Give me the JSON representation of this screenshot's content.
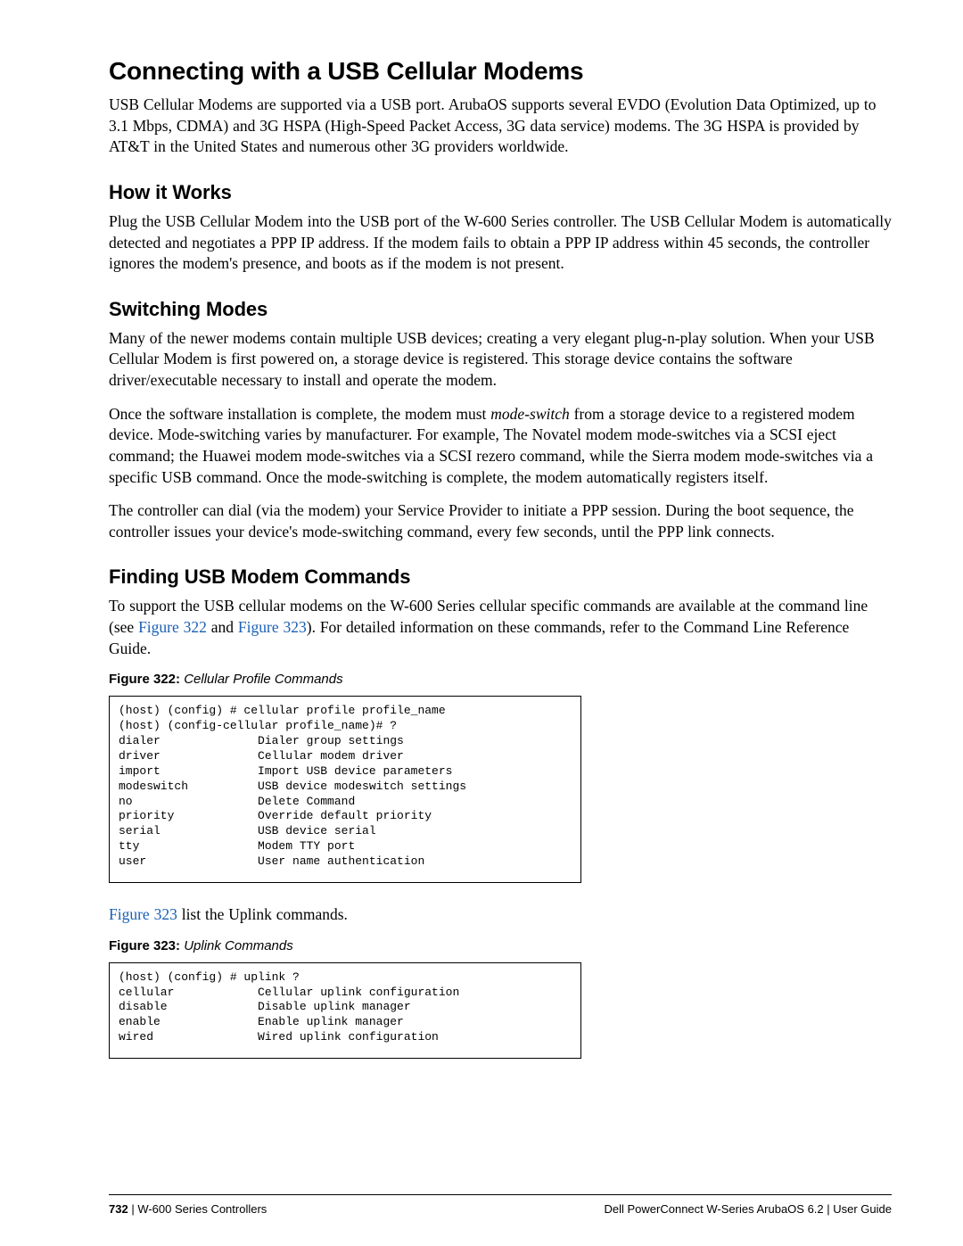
{
  "title": "Connecting with a USB Cellular Modems",
  "intro": "USB Cellular Modems are supported via a USB port. ArubaOS supports several EVDO (Evolution Data Optimized, up to 3.1 Mbps, CDMA) and 3G HSPA (High-Speed Packet Access, 3G data service) modems. The 3G HSPA is provided by AT&T in the United States and numerous other 3G providers worldwide.",
  "how": {
    "heading": "How it Works",
    "p1": "Plug the USB Cellular Modem into the USB port of the W-600 Series  controller. The USB Cellular Modem is automatically detected and negotiates a PPP IP address. If the modem fails to obtain a PPP IP address within 45 seconds, the controller ignores the modem's presence, and boots as if the modem is not present."
  },
  "switching": {
    "heading": "Switching Modes",
    "p1": "Many of the newer modems contain multiple USB devices; creating a very elegant plug-n-play solution. When your USB Cellular Modem is first powered on, a storage device is registered. This storage device contains the software driver/executable necessary to install and operate the modem.",
    "p2a": "Once the software installation is complete, the modem must ",
    "p2_em": "mode-switch",
    "p2b": " from a storage device to a registered modem device. Mode-switching varies by manufacturer. For example, The Novatel modem mode-switches via a SCSI eject command; the Huawei modem mode-switches via a SCSI rezero command, while the Sierra modem mode-switches via a specific USB command. Once the mode-switching is complete, the modem automatically registers itself.",
    "p3": "The controller can dial (via the modem) your Service Provider to initiate a PPP session. During the boot sequence, the controller issues your device's mode-switching command, every few seconds, until the PPP link connects."
  },
  "finding": {
    "heading": "Finding USB Modem Commands",
    "p1a": "To support the USB cellular modems on the W-600 Series cellular specific commands are available at the command line (see ",
    "xref1": "Figure 322",
    "p1b": " and ",
    "xref2": "Figure 323",
    "p1c": "). For detailed information on these commands, refer to the Command Line Reference Guide."
  },
  "fig322": {
    "num": "Figure 322:",
    "title": " Cellular Profile Commands",
    "code": "(host) (config) # cellular profile profile_name\n(host) (config-cellular profile_name)# ?\ndialer              Dialer group settings\ndriver              Cellular modem driver\nimport              Import USB device parameters\nmodeswitch          USB device modeswitch settings\nno                  Delete Command\npriority            Override default priority\nserial              USB device serial\ntty                 Modem TTY port\nuser                User name authentication"
  },
  "uplink_intro_a": "",
  "uplink": {
    "xref": "Figure 323",
    "tail": " list the Uplink commands."
  },
  "fig323": {
    "num": "Figure 323:",
    "title": " Uplink Commands",
    "code": "(host) (config) # uplink ?\ncellular            Cellular uplink configuration\ndisable             Disable uplink manager\nenable              Enable uplink manager\nwired               Wired uplink configuration\n"
  },
  "footer": {
    "pageno": "732",
    "left_sep": " | ",
    "left_text": "W-600 Series  Controllers",
    "right": "Dell PowerConnect W-Series ArubaOS 6.2  |  User Guide"
  }
}
